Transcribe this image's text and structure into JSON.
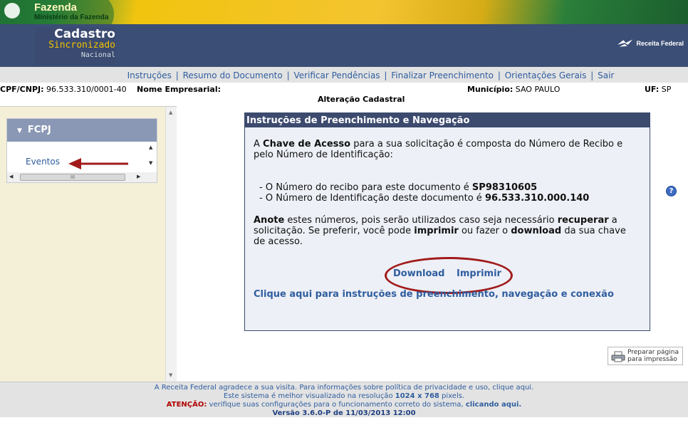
{
  "banner": {
    "title": "Fazenda",
    "subtitle": "Ministério da Fazenda"
  },
  "header": {
    "brand_line1": "Cadastro",
    "brand_line2": "Sincronizado",
    "brand_line3": "Nacional",
    "logo_text": "Receita Federal"
  },
  "nav": {
    "items": [
      "Instruções",
      "Resumo do Documento",
      "Verificar Pendências",
      "Finalizar Preenchimento",
      "Orientações Gerais",
      "Sair"
    ],
    "separator": "|"
  },
  "info": {
    "cpf_label": "CPF/CNPJ:",
    "cpf_value": "96.533.310/0001-40",
    "nome_label": "Nome Empresarial:",
    "nome_value": "",
    "municipio_label": "Município:",
    "municipio_value": "SAO PAULO",
    "uf_label": "UF:",
    "uf_value": "SP",
    "operation": "Alteração Cadastral"
  },
  "sidebar": {
    "group_label": "FCPJ",
    "item_label": "Eventos",
    "hscroll_grip": "III"
  },
  "instructions": {
    "title": "Instruções de Preenchimento e Navegação",
    "p1_a": "A ",
    "p1_b": "Chave de Acesso",
    "p1_c": " para a sua solicitação é composta do Número de Recibo e pelo Número de Identificação:",
    "line1_a": "- O Número do recibo para este documento é ",
    "line1_b": "SP98310605",
    "line2_a": "- O Número de Identificação deste documento é ",
    "line2_b": "96.533.310.000.140",
    "p2_a": "Anote",
    "p2_b": " estes números, pois serão utilizados caso seja necessário ",
    "p2_c": "recuperar",
    "p2_d": " a solicitação. Se preferir, você pode ",
    "p2_e": "imprimir",
    "p2_f": " ou fazer o ",
    "p2_g": "download",
    "p2_h": " da sua chave de acesso.",
    "download_label": "Download",
    "print_label": "Imprimir",
    "help_link": "Clique aqui para instruções de preenchimento, navegação e conexão"
  },
  "help_icon": "?",
  "print_page": {
    "line1": "Preparar página",
    "line2": "para impressão"
  },
  "footer": {
    "line1_a": "A Receita Federal agradece a sua visita. Para informações sobre política de privacidade e uso, ",
    "line1_link": "clique aqui.",
    "line2_a": "Este sistema é melhor visualizado na resolução ",
    "line2_b": "1024 x 768",
    "line2_c": " pixels.",
    "line3_attn": "ATENÇÃO:",
    "line3_a": " verifique suas configurações para o funcionamento correto do sistema, ",
    "line3_link": "clicando aqui.",
    "line4": "Versão 3.6.0-P de 11/03/2013 12:00"
  },
  "colors": {
    "header_bg": "#3b4e75",
    "nav_bg": "#e3e3e3",
    "link": "#2f5d9f",
    "panel_bg": "#f4efd7",
    "annotation_red": "#a11a1a"
  }
}
